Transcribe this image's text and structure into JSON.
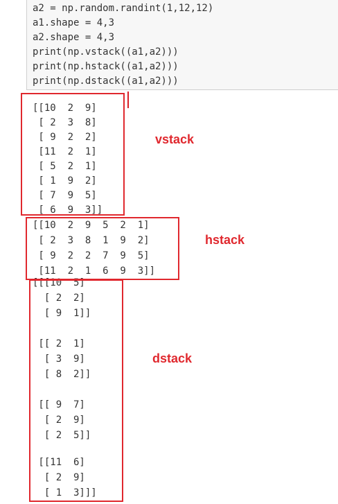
{
  "colors": {
    "annotation": "#e0282e",
    "code_background": "#f7f7f7",
    "text": "#333333"
  },
  "code_lines": [
    "a2 = np.random.randint(1,12,12)",
    "a1.shape = 4,3",
    "a2.shape = 4,3",
    "print(np.vstack((a1,a2)))",
    "print(np.hstack((a1,a2)))",
    "print(np.dstack((a1,a2)))"
  ],
  "vstack_output": [
    "[[10  2  9]",
    " [ 2  3  8]",
    " [ 9  2  2]",
    " [11  2  1]",
    " [ 5  2  1]",
    " [ 1  9  2]",
    " [ 7  9  5]",
    " [ 6  9  3]]"
  ],
  "hstack_output": [
    "[[10  2  9  5  2  1]",
    " [ 2  3  8  1  9  2]",
    " [ 9  2  2  7  9  5]",
    " [11  2  1  6  9  3]]"
  ],
  "dstack_output": [
    "[[[10  5]",
    "  [ 2  2]",
    "  [ 9  1]]",
    "",
    " [[ 2  1]",
    "  [ 3  9]",
    "  [ 8  2]]",
    "",
    " [[ 9  7]",
    "  [ 2  9]",
    "  [ 2  5]]",
    "",
    " [[11  6]",
    "  [ 2  9]",
    "  [ 1  3]]]"
  ],
  "annotations": {
    "vstack": "vstack",
    "hstack": "hstack",
    "dstack": "dstack"
  }
}
